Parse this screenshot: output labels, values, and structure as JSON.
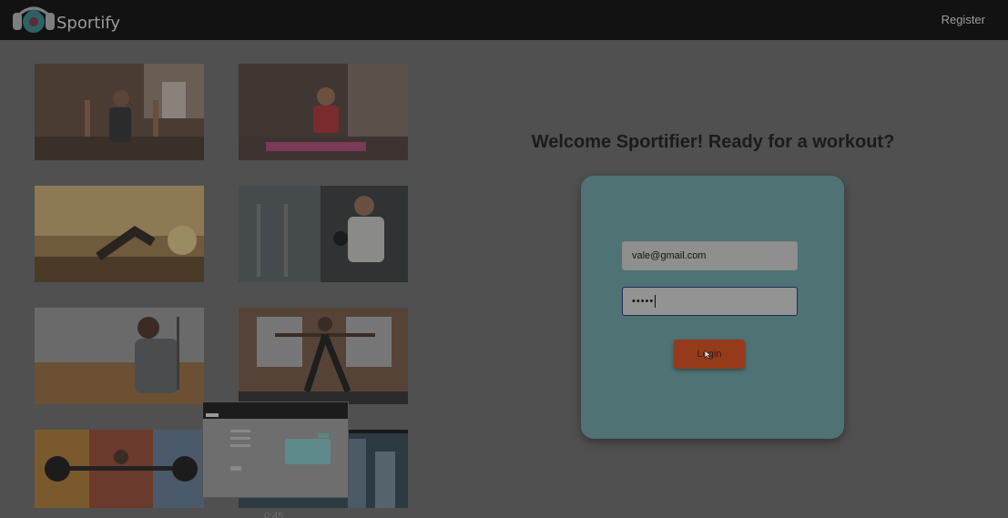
{
  "navbar": {
    "brand": "Sportify",
    "register_label": "Register"
  },
  "gallery": {
    "images": [
      {
        "name": "gym-dumbbell-class-image"
      },
      {
        "name": "yoga-mat-plank-image"
      },
      {
        "name": "outdoor-stretch-image"
      },
      {
        "name": "gym-dumbbell-curl-image"
      },
      {
        "name": "runner-field-image"
      },
      {
        "name": "yoga-warrior-pose-image"
      },
      {
        "name": "weightlifting-mural-image"
      },
      {
        "name": "city-window-image"
      }
    ]
  },
  "login": {
    "welcome": "Welcome Sportifier! Ready for a workout?",
    "email_value": "vale@gmail.com",
    "password_value": "•••••",
    "button_label": "Login"
  },
  "video": {
    "time": "0:45"
  },
  "colors": {
    "navbar_bg": "#121212",
    "card_bg": "#4f7274",
    "button_bg": "#963a1c"
  }
}
